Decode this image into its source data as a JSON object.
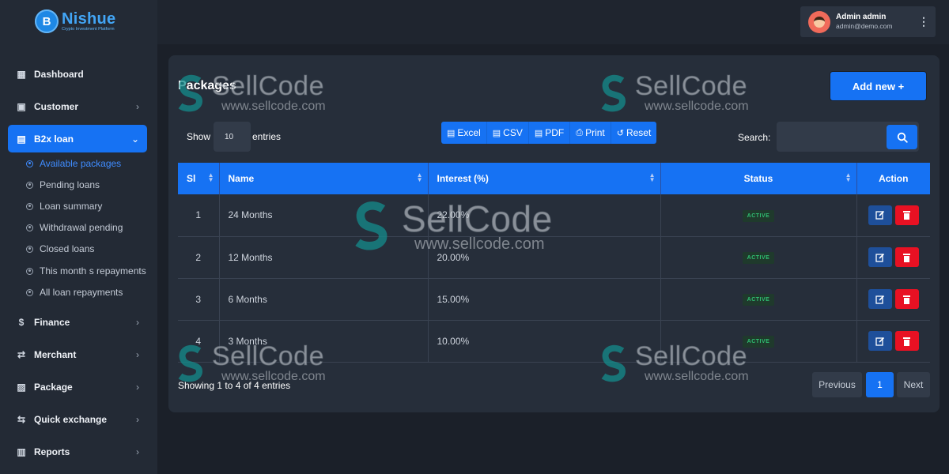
{
  "brand": {
    "logo_letter": "B",
    "name": "Nishue",
    "tagline": "Crypto Investment Platform"
  },
  "sidebar": {
    "items": [
      {
        "label": "Dashboard",
        "icon": "dashboard-icon"
      },
      {
        "label": "Customer",
        "icon": "customer-icon"
      },
      {
        "label": "B2x loan",
        "icon": "loan-icon",
        "active": true
      },
      {
        "label": "Finance",
        "icon": "finance-icon"
      },
      {
        "label": "Merchant",
        "icon": "merchant-icon"
      },
      {
        "label": "Package",
        "icon": "package-icon"
      },
      {
        "label": "Quick exchange",
        "icon": "exchange-icon"
      },
      {
        "label": "Reports",
        "icon": "reports-icon"
      }
    ],
    "subitems": [
      {
        "label": "Available packages",
        "active": true
      },
      {
        "label": "Pending loans"
      },
      {
        "label": "Loan summary"
      },
      {
        "label": "Withdrawal pending"
      },
      {
        "label": "Closed loans"
      },
      {
        "label": "This month s repayments"
      },
      {
        "label": "All loan repayments"
      }
    ]
  },
  "user": {
    "name": "Admin admin",
    "email": "admin@demo.com"
  },
  "main": {
    "title": "Packages",
    "add_button": "Add new +",
    "show_label": "Show",
    "entries_value": "10",
    "entries_label": "entries",
    "export_buttons": [
      "Excel",
      "CSV",
      "PDF",
      "Print",
      "Reset"
    ],
    "search_label": "Search:",
    "search_placeholder": "",
    "columns": [
      "Sl",
      "Name",
      "Interest (%)",
      "Status",
      "Action"
    ],
    "rows": [
      {
        "sl": "1",
        "name": "24 Months",
        "interest": "22.00%",
        "status": "ACTIVE"
      },
      {
        "sl": "2",
        "name": "12 Months",
        "interest": "20.00%",
        "status": "ACTIVE"
      },
      {
        "sl": "3",
        "name": "6 Months",
        "interest": "15.00%",
        "status": "ACTIVE"
      },
      {
        "sl": "4",
        "name": "3 Months",
        "interest": "10.00%",
        "status": "ACTIVE"
      }
    ],
    "info": "Showing 1 to 4 of 4 entries",
    "pagination": {
      "previous": "Previous",
      "current": "1",
      "next": "Next"
    }
  },
  "watermark": {
    "text": "SellCode",
    "url": "www.sellcode.com"
  },
  "colors": {
    "accent": "#1672f3",
    "danger": "#e81123",
    "success": "#2fbf71",
    "background": "#1b2029"
  }
}
